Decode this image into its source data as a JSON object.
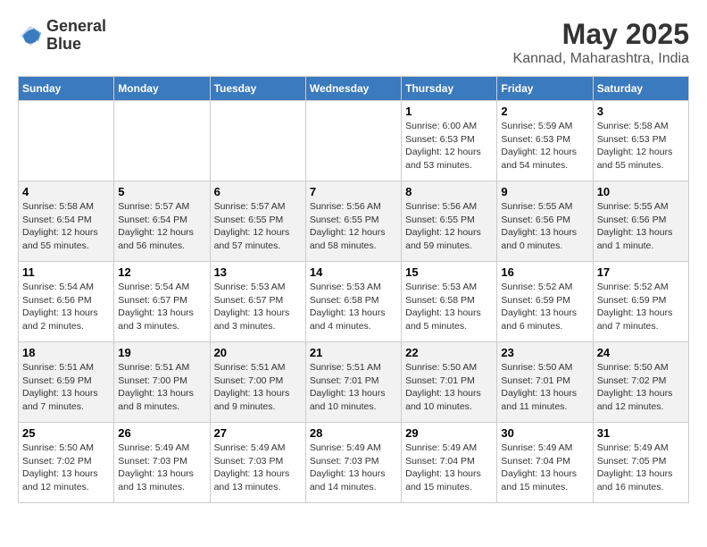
{
  "header": {
    "logo_line1": "General",
    "logo_line2": "Blue",
    "month": "May 2025",
    "location": "Kannad, Maharashtra, India"
  },
  "weekdays": [
    "Sunday",
    "Monday",
    "Tuesday",
    "Wednesday",
    "Thursday",
    "Friday",
    "Saturday"
  ],
  "weeks": [
    [
      {
        "day": "",
        "info": ""
      },
      {
        "day": "",
        "info": ""
      },
      {
        "day": "",
        "info": ""
      },
      {
        "day": "",
        "info": ""
      },
      {
        "day": "1",
        "info": "Sunrise: 6:00 AM\nSunset: 6:53 PM\nDaylight: 12 hours\nand 53 minutes."
      },
      {
        "day": "2",
        "info": "Sunrise: 5:59 AM\nSunset: 6:53 PM\nDaylight: 12 hours\nand 54 minutes."
      },
      {
        "day": "3",
        "info": "Sunrise: 5:58 AM\nSunset: 6:53 PM\nDaylight: 12 hours\nand 55 minutes."
      }
    ],
    [
      {
        "day": "4",
        "info": "Sunrise: 5:58 AM\nSunset: 6:54 PM\nDaylight: 12 hours\nand 55 minutes."
      },
      {
        "day": "5",
        "info": "Sunrise: 5:57 AM\nSunset: 6:54 PM\nDaylight: 12 hours\nand 56 minutes."
      },
      {
        "day": "6",
        "info": "Sunrise: 5:57 AM\nSunset: 6:55 PM\nDaylight: 12 hours\nand 57 minutes."
      },
      {
        "day": "7",
        "info": "Sunrise: 5:56 AM\nSunset: 6:55 PM\nDaylight: 12 hours\nand 58 minutes."
      },
      {
        "day": "8",
        "info": "Sunrise: 5:56 AM\nSunset: 6:55 PM\nDaylight: 12 hours\nand 59 minutes."
      },
      {
        "day": "9",
        "info": "Sunrise: 5:55 AM\nSunset: 6:56 PM\nDaylight: 13 hours\nand 0 minutes."
      },
      {
        "day": "10",
        "info": "Sunrise: 5:55 AM\nSunset: 6:56 PM\nDaylight: 13 hours\nand 1 minute."
      }
    ],
    [
      {
        "day": "11",
        "info": "Sunrise: 5:54 AM\nSunset: 6:56 PM\nDaylight: 13 hours\nand 2 minutes."
      },
      {
        "day": "12",
        "info": "Sunrise: 5:54 AM\nSunset: 6:57 PM\nDaylight: 13 hours\nand 3 minutes."
      },
      {
        "day": "13",
        "info": "Sunrise: 5:53 AM\nSunset: 6:57 PM\nDaylight: 13 hours\nand 3 minutes."
      },
      {
        "day": "14",
        "info": "Sunrise: 5:53 AM\nSunset: 6:58 PM\nDaylight: 13 hours\nand 4 minutes."
      },
      {
        "day": "15",
        "info": "Sunrise: 5:53 AM\nSunset: 6:58 PM\nDaylight: 13 hours\nand 5 minutes."
      },
      {
        "day": "16",
        "info": "Sunrise: 5:52 AM\nSunset: 6:59 PM\nDaylight: 13 hours\nand 6 minutes."
      },
      {
        "day": "17",
        "info": "Sunrise: 5:52 AM\nSunset: 6:59 PM\nDaylight: 13 hours\nand 7 minutes."
      }
    ],
    [
      {
        "day": "18",
        "info": "Sunrise: 5:51 AM\nSunset: 6:59 PM\nDaylight: 13 hours\nand 7 minutes."
      },
      {
        "day": "19",
        "info": "Sunrise: 5:51 AM\nSunset: 7:00 PM\nDaylight: 13 hours\nand 8 minutes."
      },
      {
        "day": "20",
        "info": "Sunrise: 5:51 AM\nSunset: 7:00 PM\nDaylight: 13 hours\nand 9 minutes."
      },
      {
        "day": "21",
        "info": "Sunrise: 5:51 AM\nSunset: 7:01 PM\nDaylight: 13 hours\nand 10 minutes."
      },
      {
        "day": "22",
        "info": "Sunrise: 5:50 AM\nSunset: 7:01 PM\nDaylight: 13 hours\nand 10 minutes."
      },
      {
        "day": "23",
        "info": "Sunrise: 5:50 AM\nSunset: 7:01 PM\nDaylight: 13 hours\nand 11 minutes."
      },
      {
        "day": "24",
        "info": "Sunrise: 5:50 AM\nSunset: 7:02 PM\nDaylight: 13 hours\nand 12 minutes."
      }
    ],
    [
      {
        "day": "25",
        "info": "Sunrise: 5:50 AM\nSunset: 7:02 PM\nDaylight: 13 hours\nand 12 minutes."
      },
      {
        "day": "26",
        "info": "Sunrise: 5:49 AM\nSunset: 7:03 PM\nDaylight: 13 hours\nand 13 minutes."
      },
      {
        "day": "27",
        "info": "Sunrise: 5:49 AM\nSunset: 7:03 PM\nDaylight: 13 hours\nand 13 minutes."
      },
      {
        "day": "28",
        "info": "Sunrise: 5:49 AM\nSunset: 7:03 PM\nDaylight: 13 hours\nand 14 minutes."
      },
      {
        "day": "29",
        "info": "Sunrise: 5:49 AM\nSunset: 7:04 PM\nDaylight: 13 hours\nand 15 minutes."
      },
      {
        "day": "30",
        "info": "Sunrise: 5:49 AM\nSunset: 7:04 PM\nDaylight: 13 hours\nand 15 minutes."
      },
      {
        "day": "31",
        "info": "Sunrise: 5:49 AM\nSunset: 7:05 PM\nDaylight: 13 hours\nand 16 minutes."
      }
    ]
  ]
}
